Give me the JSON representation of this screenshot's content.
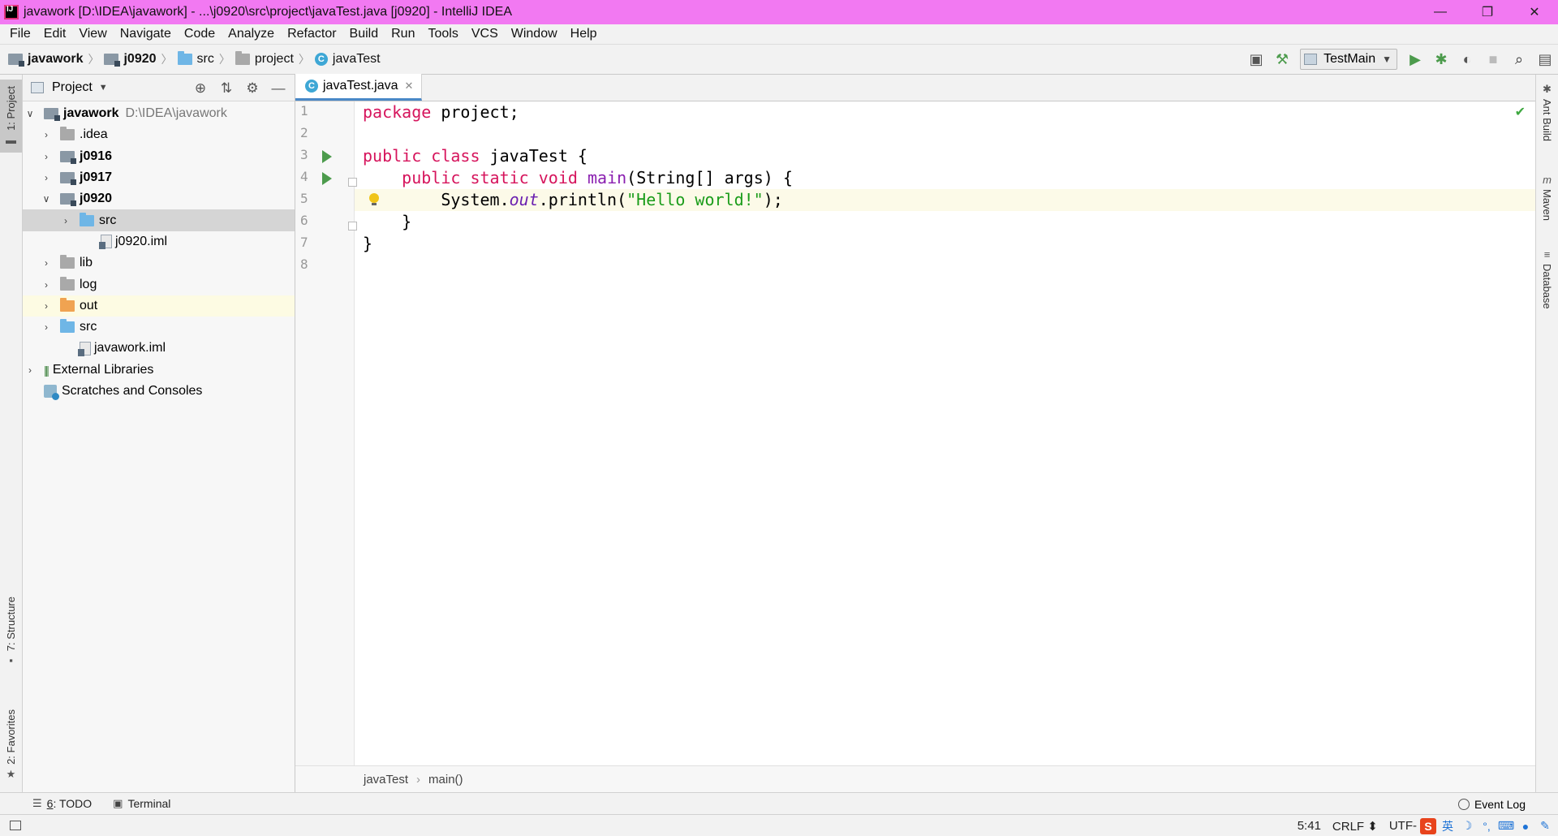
{
  "window": {
    "title": "javawork [D:\\IDEA\\javawork] - ...\\j0920\\src\\project\\javaTest.java [j0920] - IntelliJ IDEA",
    "controls": [
      "—",
      "❐",
      "✕"
    ]
  },
  "menu": [
    "File",
    "Edit",
    "View",
    "Navigate",
    "Code",
    "Analyze",
    "Refactor",
    "Build",
    "Run",
    "Tools",
    "VCS",
    "Window",
    "Help"
  ],
  "navbar": {
    "crumbs": [
      "javawork",
      "j0920",
      "src",
      "project",
      "javaTest"
    ],
    "run_config": "TestMain"
  },
  "left_stripe": {
    "project": "1: Project",
    "structure": "7: Structure",
    "favorites": "2: Favorites"
  },
  "right_stripe": {
    "ant": "Ant Build",
    "maven": "Maven",
    "database": "Database"
  },
  "project_panel": {
    "title": "Project",
    "tree": [
      {
        "name": "javawork",
        "path": "D:\\IDEA\\javawork"
      },
      {
        "name": ".idea"
      },
      {
        "name": "j0916"
      },
      {
        "name": "j0917"
      },
      {
        "name": "j0920"
      },
      {
        "name": "src"
      },
      {
        "name": "j0920.iml"
      },
      {
        "name": "lib"
      },
      {
        "name": "log"
      },
      {
        "name": "out"
      },
      {
        "name": "src"
      },
      {
        "name": "javawork.iml"
      },
      {
        "name": "External Libraries"
      },
      {
        "name": "Scratches and Consoles"
      }
    ]
  },
  "editor": {
    "tab": "javaTest.java",
    "line_numbers": [
      "1",
      "2",
      "3",
      "4",
      "5",
      "6",
      "7",
      "8"
    ],
    "code": {
      "l1_kw": "package",
      "l1_rest": " project;",
      "l3_kw1": "public",
      "l3_kw2": "class",
      "l3_rest": " javaTest {",
      "l4_indent": "    ",
      "l4_kw1": "public",
      "l4_kw2": "static",
      "l4_kw3": "void",
      "l4_fn": "main",
      "l4_rest": "(String[] args) {",
      "l5_pre": "        System.",
      "l5_field": "out",
      "l5_mid": ".println(",
      "l5_str": "\"Hello world!\"",
      "l5_end": ");",
      "l6": "    }",
      "l7": "}"
    },
    "breadcrumb": [
      "javaTest",
      "main()"
    ]
  },
  "bottom_tools": {
    "todo_prefix": "6",
    "todo_label": ": TODO",
    "terminal": "Terminal",
    "event_log": "Event Log"
  },
  "status": {
    "position": "5:41",
    "line_sep": "CRLF",
    "encoding": "UTF-",
    "ime_lang": "英"
  },
  "colors": {
    "title_bar": "#f279f2",
    "keyword": "#d6145c",
    "string": "#1a9c1a",
    "run_icon": "#4c9b4c",
    "selection": "#d5d5d5"
  }
}
